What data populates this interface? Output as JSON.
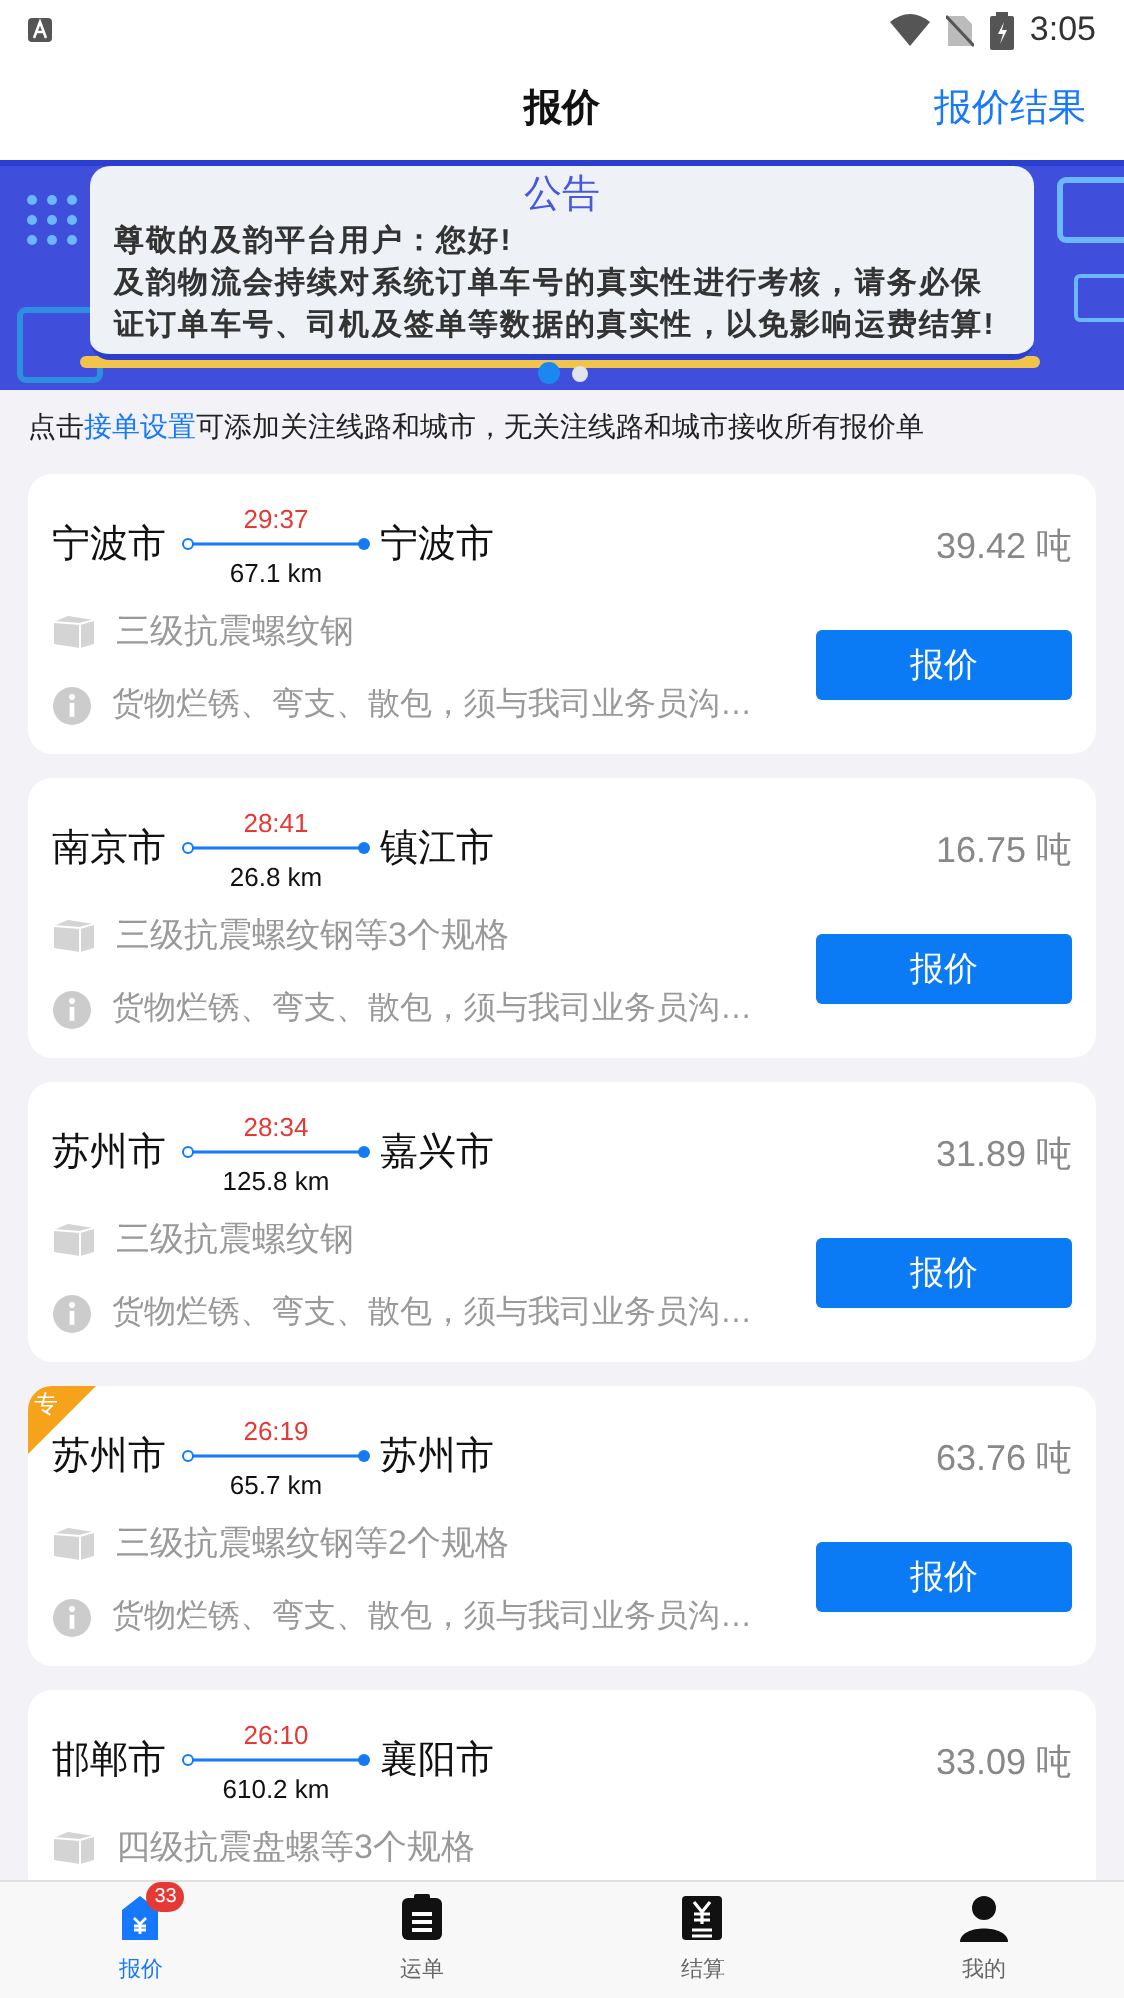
{
  "status_bar": {
    "time": "3:05"
  },
  "header": {
    "title": "报价",
    "action": "报价结果"
  },
  "banner": {
    "title": "公告",
    "lines": [
      "尊敬的及韵平台用户：您好!",
      "及韵物流会持续对系统订单车号的真实性进行考核，请务必保证订单车号、司机及签单等数据的真实性，以免影响运费结算!"
    ],
    "dots": [
      {
        "selected": true
      },
      {
        "selected": false
      }
    ]
  },
  "hint": {
    "before": "点击",
    "link": "接单设置",
    "after": "可添加关注线路和城市，无关注线路和城市接收所有报价单"
  },
  "cards": [
    {
      "from": "宁波市",
      "to": "宁波市",
      "time": "29:37",
      "distance": "67.1 km",
      "weight": "39.42 吨",
      "goods": "三级抗震螺纹钢",
      "note": "货物烂锈、弯支、散包，须与我司业务员沟…",
      "button": "报价",
      "special": false
    },
    {
      "from": "南京市",
      "to": "镇江市",
      "time": "28:41",
      "distance": "26.8 km",
      "weight": "16.75 吨",
      "goods": "三级抗震螺纹钢等3个规格",
      "note": "货物烂锈、弯支、散包，须与我司业务员沟…",
      "button": "报价",
      "special": false
    },
    {
      "from": "苏州市",
      "to": "嘉兴市",
      "time": "28:34",
      "distance": "125.8 km",
      "weight": "31.89 吨",
      "goods": "三级抗震螺纹钢",
      "note": "货物烂锈、弯支、散包，须与我司业务员沟…",
      "button": "报价",
      "special": false
    },
    {
      "from": "苏州市",
      "to": "苏州市",
      "time": "26:19",
      "distance": "65.7 km",
      "weight": "63.76 吨",
      "goods": "三级抗震螺纹钢等2个规格",
      "note": "货物烂锈、弯支、散包，须与我司业务员沟…",
      "button": "报价",
      "special": true,
      "special_label": "专"
    },
    {
      "from": "邯郸市",
      "to": "襄阳市",
      "time": "26:10",
      "distance": "610.2 km",
      "weight": "33.09 吨",
      "goods": "四级抗震盘螺等3个规格",
      "special": false
    }
  ],
  "tabs": [
    {
      "label": "报价",
      "selected": true,
      "badge": "33"
    },
    {
      "label": "运单",
      "selected": false
    },
    {
      "label": "结算",
      "selected": false
    },
    {
      "label": "我的",
      "selected": false
    }
  ]
}
